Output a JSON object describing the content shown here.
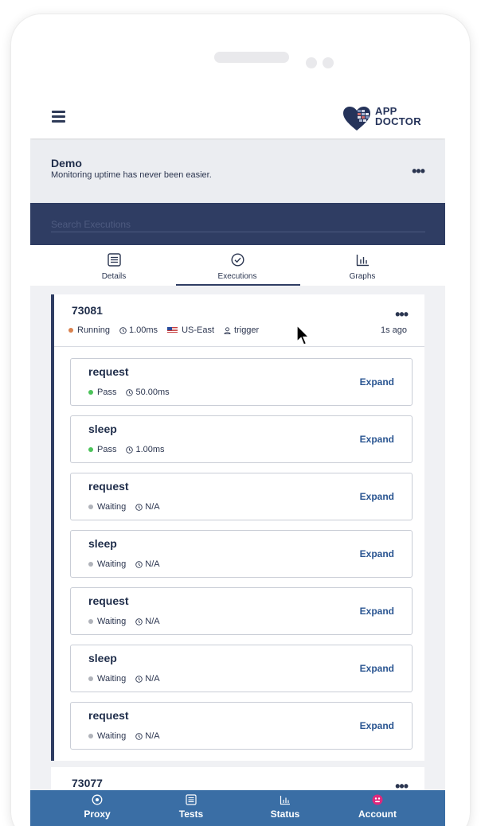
{
  "header": {
    "logo_line1": "APP",
    "logo_line2": "DOCTOR"
  },
  "org": {
    "name": "Demo",
    "subtitle": "Monitoring uptime has never been easier."
  },
  "search": {
    "placeholder": "Search Executions"
  },
  "tabs": [
    {
      "label": "Details",
      "icon": "list-icon"
    },
    {
      "label": "Executions",
      "icon": "check-circle-icon",
      "active": true
    },
    {
      "label": "Graphs",
      "icon": "bar-chart-icon"
    }
  ],
  "execution": {
    "id": "73081",
    "status": "Running",
    "duration": "1.00ms",
    "region": "US-East",
    "trigger": "trigger",
    "time_ago": "1s ago",
    "status_color": "#d9824f",
    "steps": [
      {
        "name": "request",
        "status": "Pass",
        "duration": "50.00ms",
        "action": "Expand",
        "status_color": "#4cc35a"
      },
      {
        "name": "sleep",
        "status": "Pass",
        "duration": "1.00ms",
        "action": "Expand",
        "status_color": "#4cc35a"
      },
      {
        "name": "request",
        "status": "Waiting",
        "duration": "N/A",
        "action": "Expand",
        "status_color": "#b0b3ba"
      },
      {
        "name": "sleep",
        "status": "Waiting",
        "duration": "N/A",
        "action": "Expand",
        "status_color": "#b0b3ba"
      },
      {
        "name": "request",
        "status": "Waiting",
        "duration": "N/A",
        "action": "Expand",
        "status_color": "#b0b3ba"
      },
      {
        "name": "sleep",
        "status": "Waiting",
        "duration": "N/A",
        "action": "Expand",
        "status_color": "#b0b3ba"
      },
      {
        "name": "request",
        "status": "Waiting",
        "duration": "N/A",
        "action": "Expand",
        "status_color": "#b0b3ba"
      }
    ]
  },
  "next_execution": {
    "id": "73077"
  },
  "bottom_nav": [
    {
      "label": "Proxy",
      "icon": "target-icon"
    },
    {
      "label": "Tests",
      "icon": "list-icon"
    },
    {
      "label": "Status",
      "icon": "bar-chart-icon"
    },
    {
      "label": "Account",
      "icon": "avatar-icon"
    }
  ],
  "colors": {
    "navy": "#2f3d63",
    "bottom_nav": "#3a6ea5",
    "link": "#2a5591"
  }
}
